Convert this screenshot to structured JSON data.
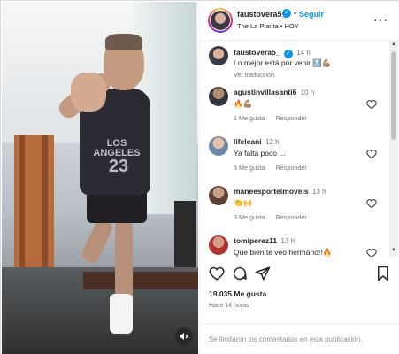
{
  "header": {
    "username": "faustovera5_",
    "verified_glyph": "✓",
    "separator": "•",
    "follow_label": "Seguir",
    "location": "The La Planta • HOY",
    "more_glyph": "···"
  },
  "media": {
    "jersey_text": "LOS ANGELES",
    "jersey_number": "23",
    "mute_icon": "speaker-muted-icon"
  },
  "caption": {
    "username": "faustovera5_",
    "time": "14 h",
    "text": "Lo mejor está por venir 🔝💪🏽",
    "translate_label": "Ver traducción"
  },
  "comments": [
    {
      "username": "agustinvillasanti6",
      "time": "10 h",
      "text": "🔥💪🏽",
      "likes": "1 Me gusta",
      "reply": "Responder"
    },
    {
      "username": "lifeleani",
      "time": "12 h",
      "text": "Ya falta poco ...",
      "likes": "5 Me gusta",
      "reply": "Responder"
    },
    {
      "username": "maneesporteimoveis",
      "time": "13 h",
      "text": "👏🙌",
      "likes": "3 Me gusta",
      "reply": "Responder"
    },
    {
      "username": "tomiperez11",
      "time": "13 h",
      "text": "Que bien te veo hermano!!🔥"
    }
  ],
  "stats": {
    "likes": "19.035 Me gusta",
    "posted": "Hace 14 horas"
  },
  "comment_input": {
    "disabled_text": "Se limitaron los comentarios en esta publicación."
  },
  "colors": {
    "accent": "#0095f6",
    "muted": "#737373",
    "text": "#262626"
  }
}
